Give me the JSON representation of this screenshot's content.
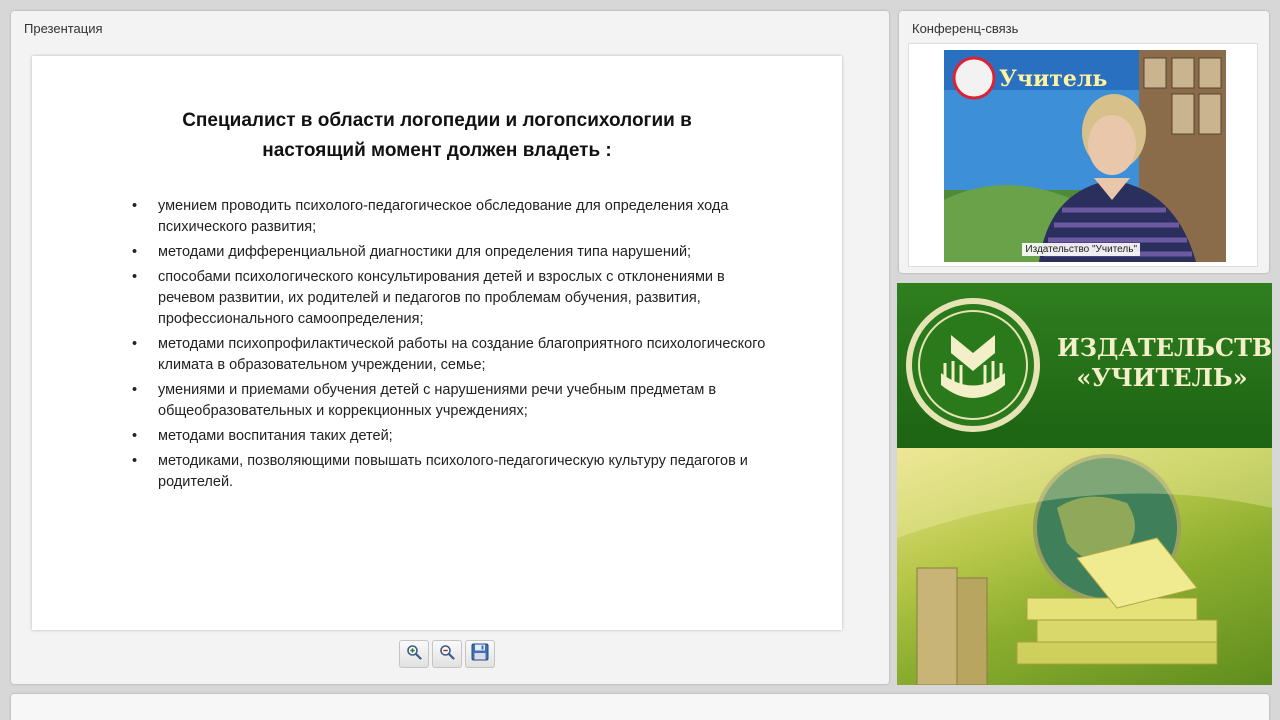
{
  "presentation_panel": {
    "title": "Презентация",
    "slide": {
      "title_lines": [
        "Специалист в области логопедии и логопсихологии в",
        "настоящий момент должен владеть :"
      ],
      "bullets": [
        "умением проводить психолого-педагогическое обследование для определения хода психического развития;",
        "методами дифференциальной диагностики для определения типа нарушений;",
        "способами психологического консультирования детей и взрослых с отклонениями в речевом развитии, их родителей и педагогов по проблемам обучения, развития, профессионального самоопределения;",
        "методами психопрофилактической работы на создание благоприятного психологического климата в образовательном учреждении, семье;",
        "умениями и приемами обучения детей с нарушениями речи учебным предметам в общеобразовательных и коррекционных учреждениях;",
        "методами воспитания таких детей;",
        "методиками, позволяющими повышать психолого-педагогическую культуру педагогов и родителей."
      ]
    },
    "toolbar": {
      "zoom_in_icon": "zoom-in-icon",
      "zoom_out_icon": "zoom-out-icon",
      "save_icon": "floppy-disk-icon"
    }
  },
  "conference_panel": {
    "title": "Конференц-связь",
    "video_caption": "Издательство \"Учитель\""
  },
  "banner": {
    "line1": "ИЗДАТЕЛЬСТВО",
    "line2": "«УЧИТЕЛЬ»"
  },
  "colors": {
    "banner_green": "#1d6313",
    "banner_text": "#f2efc9",
    "background": "#d7d7d7"
  }
}
